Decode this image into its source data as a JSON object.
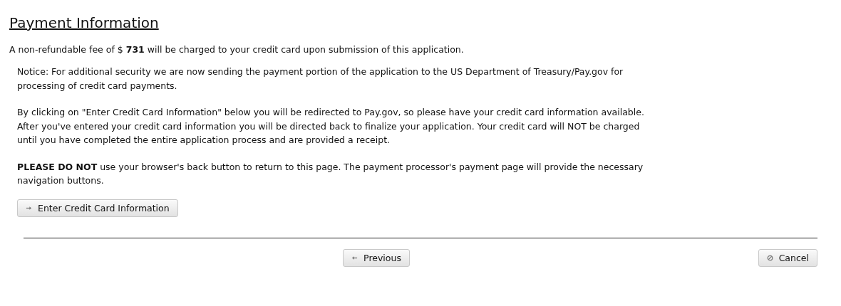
{
  "title": "Payment Information",
  "fee_text": "A non-refundable fee of $ **731** will be charged to your credit card upon submission of this application.",
  "notice_paragraphs": [
    "Notice: For additional security we are now sending the payment portion of the application to the US Department of Treasury/Pay.gov for processing of credit card payments.",
    "By clicking on \"Enter Credit Card Information\" below you will be redirected to Pay.gov, so please have your credit card information available. After you've entered your credit card information you will be directed back to finalize your application. Your credit card will NOT be charged until you have completed the entire application process and are provided a receipt.",
    "**PLEASE DO NOT** use your browser's back button to return to this page. The payment processor's payment page will provide the necessary navigation buttons."
  ],
  "pay_button": {
    "label": "Enter Credit Card Information",
    "kind": "forward"
  },
  "nav_buttons": [
    {
      "label": "Previous",
      "kind": "back"
    },
    {
      "label": "Cancel",
      "kind": "cancel"
    }
  ]
}
